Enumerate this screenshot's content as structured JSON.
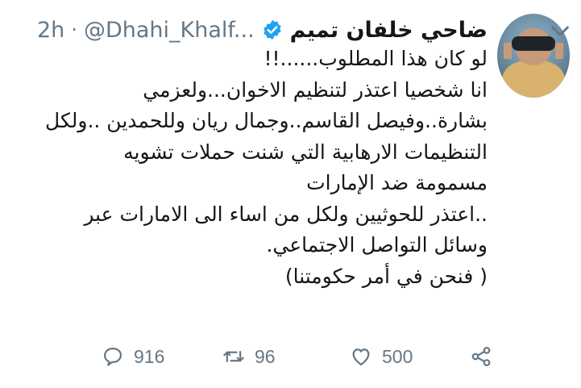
{
  "tweet": {
    "author_name": "ضاحي خلفان تميم",
    "handle": "@Dhahi_Khalf...",
    "separator": "·",
    "time": "2h",
    "verified": true,
    "lines": [
      "لو كان هذا المطلوب......!!",
      "انا شخصيا اعتذر لتنظيم الاخوان...ولعزمي",
      "بشارة..وفيصل القاسم..وجمال ريان وللحمدين ..ولكل",
      "التنظيمات الارهابية التي شنت حملات تشويه",
      "مسمومة ضد الإمارات",
      "..اعتذر للحوثيين ولكل من اساء الى الامارات عبر",
      "وسائل التواصل الاجتماعي.",
      "( فنحن في أمر حكومتنا)"
    ]
  },
  "actions": {
    "replies": "916",
    "retweets": "96",
    "likes": "500"
  },
  "icons": {
    "verified": "verified-badge-icon",
    "menu": "chevron-down-icon",
    "reply": "reply-icon",
    "retweet": "retweet-icon",
    "like": "heart-icon",
    "share": "share-icon"
  },
  "colors": {
    "verified_blue": "#1da1f2",
    "text": "#14171a",
    "muted": "#657786"
  }
}
